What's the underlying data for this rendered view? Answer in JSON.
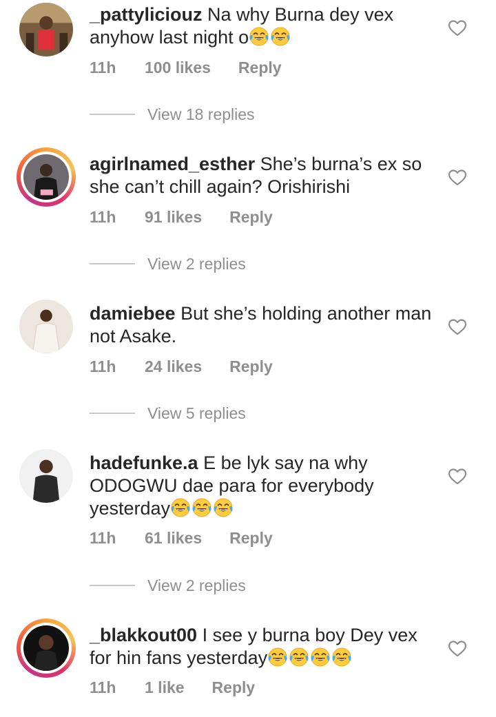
{
  "comments": [
    {
      "username": "_pattyliciouz",
      "text": "Na why Burna dey vex anyhow last night o",
      "emoji_count": 2,
      "time": "11h",
      "likes": "100 likes",
      "reply": "Reply",
      "view_replies": "View 18 replies",
      "has_story_ring": false
    },
    {
      "username": "agirlnamed_esther",
      "text": "She’s burna’s ex so she can’t chill again? Orishirishi",
      "emoji_count": 0,
      "time": "11h",
      "likes": "91 likes",
      "reply": "Reply",
      "view_replies": "View 2 replies",
      "has_story_ring": true
    },
    {
      "username": "damiebee",
      "text": "But she’s holding another man not Asake.",
      "emoji_count": 0,
      "time": "11h",
      "likes": "24 likes",
      "reply": "Reply",
      "view_replies": "View 5 replies",
      "has_story_ring": false
    },
    {
      "username": "hadefunke.a",
      "text": "E be lyk say na why ODOGWU dae para for everybody yesterday",
      "emoji_count": 3,
      "time": "11h",
      "likes": "61 likes",
      "reply": "Reply",
      "view_replies": "View 2 replies",
      "has_story_ring": false
    },
    {
      "username": "_blakkout00",
      "text": "I see y burna boy Dey vex for hin fans yesterday",
      "emoji_count": 4,
      "time": "11h",
      "likes": "1 like",
      "reply": "Reply",
      "has_story_ring": true
    }
  ],
  "icons": {
    "like": "heart-outline-icon",
    "emoji": "face-with-tears-of-joy"
  },
  "colors": {
    "text": "#262626",
    "meta": "#8e8e8e",
    "divider": "#c7c7c7"
  }
}
